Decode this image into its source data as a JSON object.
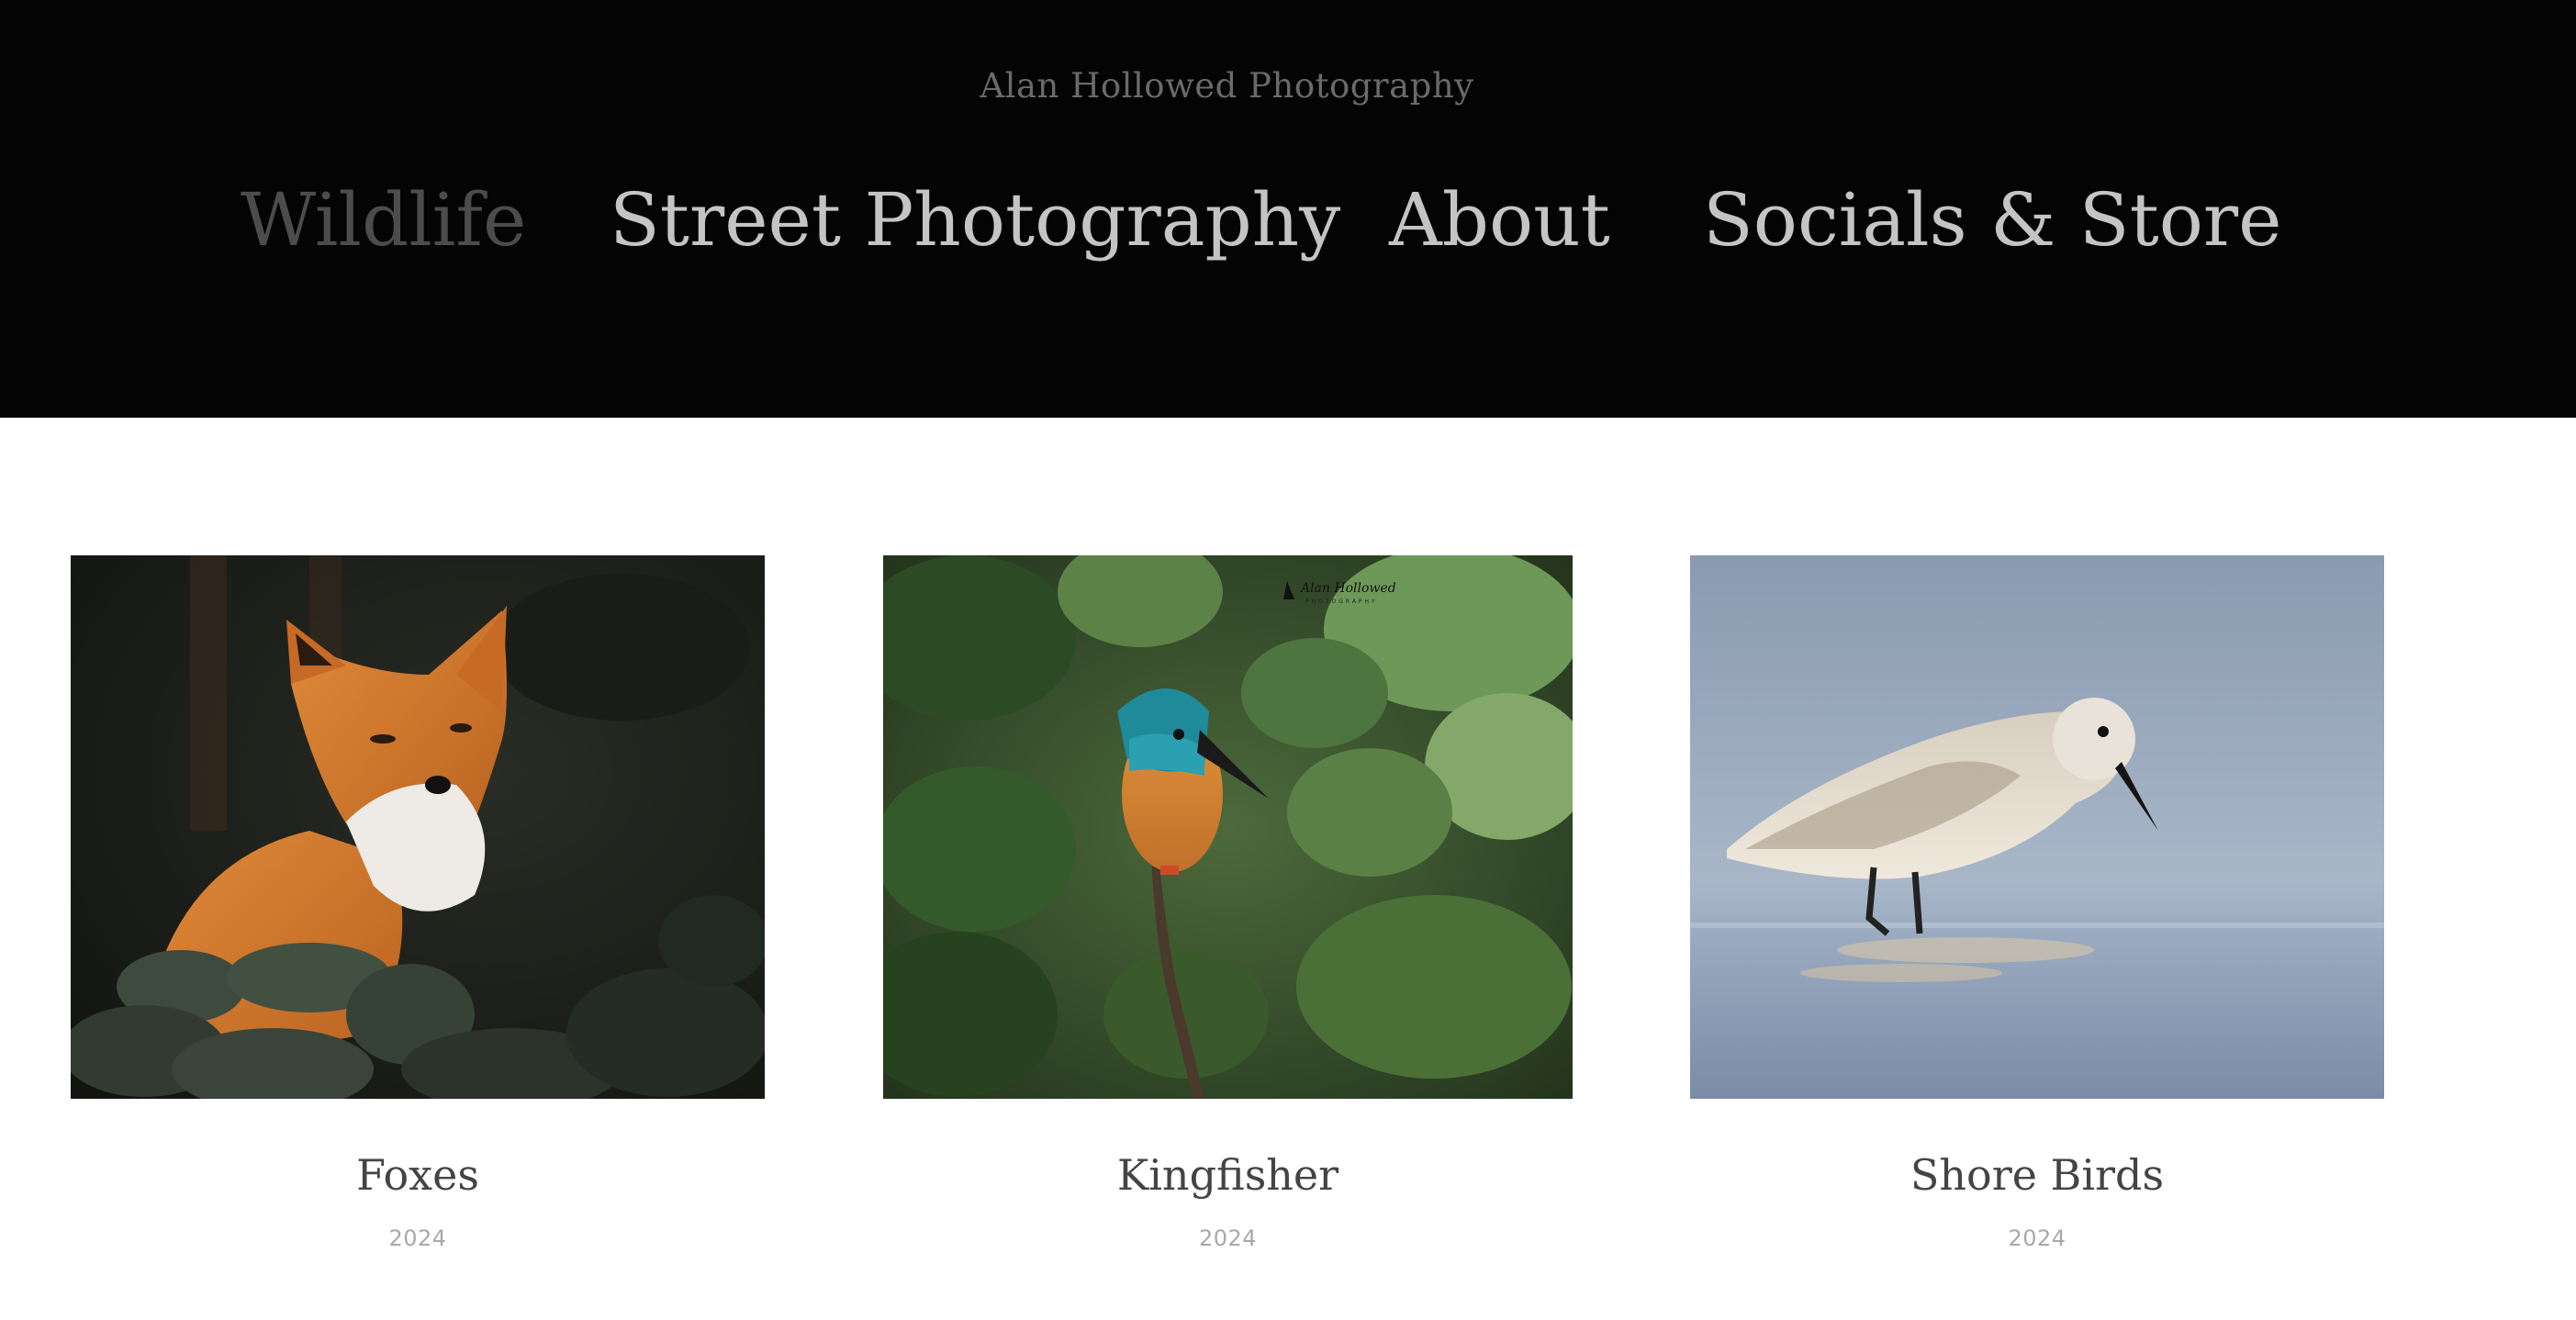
{
  "site": {
    "title": "Alan Hollowed Photography"
  },
  "nav": {
    "items": [
      {
        "label": "Wildlife",
        "active": true
      },
      {
        "label": "Street Photography",
        "active": false
      },
      {
        "label": "About",
        "active": false
      },
      {
        "label": "Socials & Store",
        "active": false
      }
    ]
  },
  "gallery": {
    "items": [
      {
        "title": "Foxes",
        "year": "2024",
        "image": "red fox among leaves"
      },
      {
        "title": "Kingfisher",
        "year": "2024",
        "image": "kingfisher perched on branch"
      },
      {
        "title": "Shore Birds",
        "year": "2024",
        "image": "sanderling wading in water"
      }
    ]
  },
  "colors": {
    "header_bg": "#040404",
    "nav_text": "#c4c4c4",
    "nav_active": "#4c4c4c",
    "title_text": "#6a6a6a",
    "caption_text": "#444444",
    "year_text": "#a8a8a8"
  }
}
